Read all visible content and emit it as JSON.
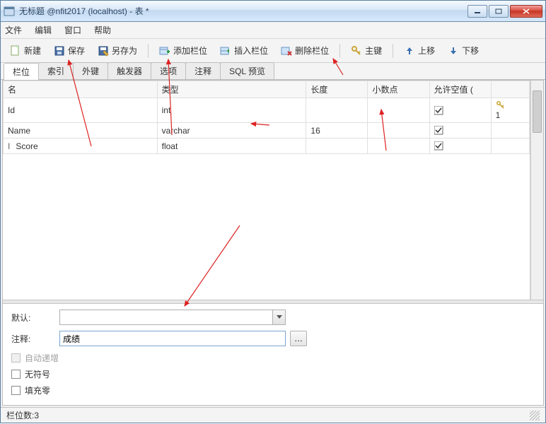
{
  "title": "无标题 @nfit2017 (localhost) - 表 *",
  "menu": {
    "file": "文件",
    "edit": "编辑",
    "window": "窗口",
    "help": "帮助"
  },
  "toolbar": {
    "new": "新建",
    "save": "保存",
    "saveas": "另存为",
    "addcol": "添加栏位",
    "insertcol": "插入栏位",
    "delcol": "删除栏位",
    "pkey": "主键",
    "moveup": "上移",
    "movedown": "下移"
  },
  "tabs": {
    "fields": "栏位",
    "indexes": "索引",
    "fk": "外键",
    "trigger": "触发器",
    "options": "选项",
    "comment": "注释",
    "sqlpreview": "SQL 预览"
  },
  "columns": {
    "name": "名",
    "type": "类型",
    "len": "长度",
    "dec": "小数点",
    "null": "允许空值 ("
  },
  "rows": [
    {
      "name": "Id",
      "type": "int",
      "len": "",
      "dec": "",
      "null": true,
      "key": "1"
    },
    {
      "name": "Name",
      "type": "varchar",
      "len": "16",
      "dec": "",
      "null": true,
      "key": ""
    },
    {
      "name": "Score",
      "type": "float",
      "len": "",
      "dec": "",
      "null": true,
      "key": ""
    }
  ],
  "props": {
    "default_label": "默认:",
    "comment_label": "注释:",
    "comment_value": "成绩",
    "autoinc": "自动递增",
    "unsigned": "无符号",
    "zerofill": "填充零"
  },
  "status": {
    "fieldcount_label": "栏位数: ",
    "fieldcount": "3"
  }
}
